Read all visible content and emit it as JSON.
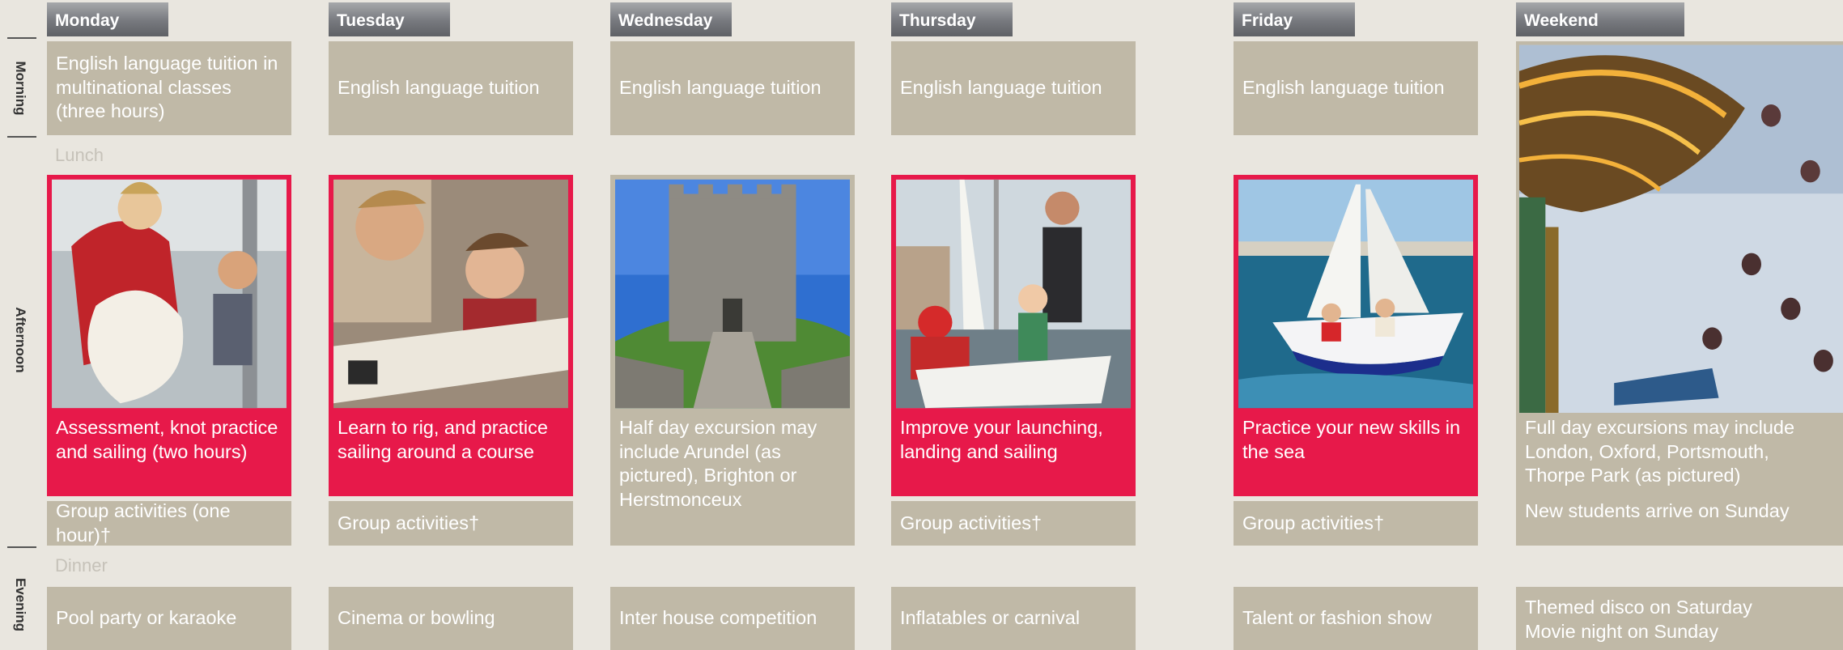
{
  "side_labels": {
    "morning": "Morning",
    "afternoon": "Afternoon",
    "evening": "Evening"
  },
  "meals": {
    "lunch": "Lunch",
    "dinner": "Dinner"
  },
  "days": [
    {
      "name": "Monday",
      "morning": "English language tuition in multinational classes (three hours)",
      "afternoon": "Assessment, knot practice and sailing (two hours)",
      "group": "Group activities (one hour)†",
      "evening": "Pool party or karaoke",
      "photo": "sailing-knots"
    },
    {
      "name": "Tuesday",
      "morning": "English language tuition",
      "afternoon": "Learn to rig, and practice sailing around a course",
      "group": "Group activities†",
      "evening": "Cinema or bowling",
      "photo": "rigging"
    },
    {
      "name": "Wednesday",
      "morning": "English language tuition",
      "afternoon": "Half day excursion may include  Arundel (as pictured), Brighton or Herstmonceux",
      "evening": "Inter house competition",
      "photo": "arundel-castle"
    },
    {
      "name": "Thursday",
      "morning": "English language tuition",
      "afternoon": "Improve your launching, landing and sailing",
      "group": "Group activities†",
      "evening": "Inflatables or carnival",
      "photo": "launching"
    },
    {
      "name": "Friday",
      "morning": "English language tuition",
      "afternoon": "Practice your new skills in the sea",
      "group": "Group activities†",
      "evening": "Talent or fashion show",
      "photo": "sea-sailing"
    },
    {
      "name": "Weekend",
      "afternoon": "Full day excursions may include London, Oxford, Portsmouth, Thorpe Park (as pictured)",
      "arrival": "New students arrive on Sunday",
      "evening_1": "Themed disco on Saturday",
      "evening_2": "Movie night on Sunday",
      "photo": "thorpe-park-ride"
    }
  ],
  "colors": {
    "accent_red": "#e7194a",
    "panel_beige": "#c0b9a7",
    "background": "#e9e6df"
  }
}
